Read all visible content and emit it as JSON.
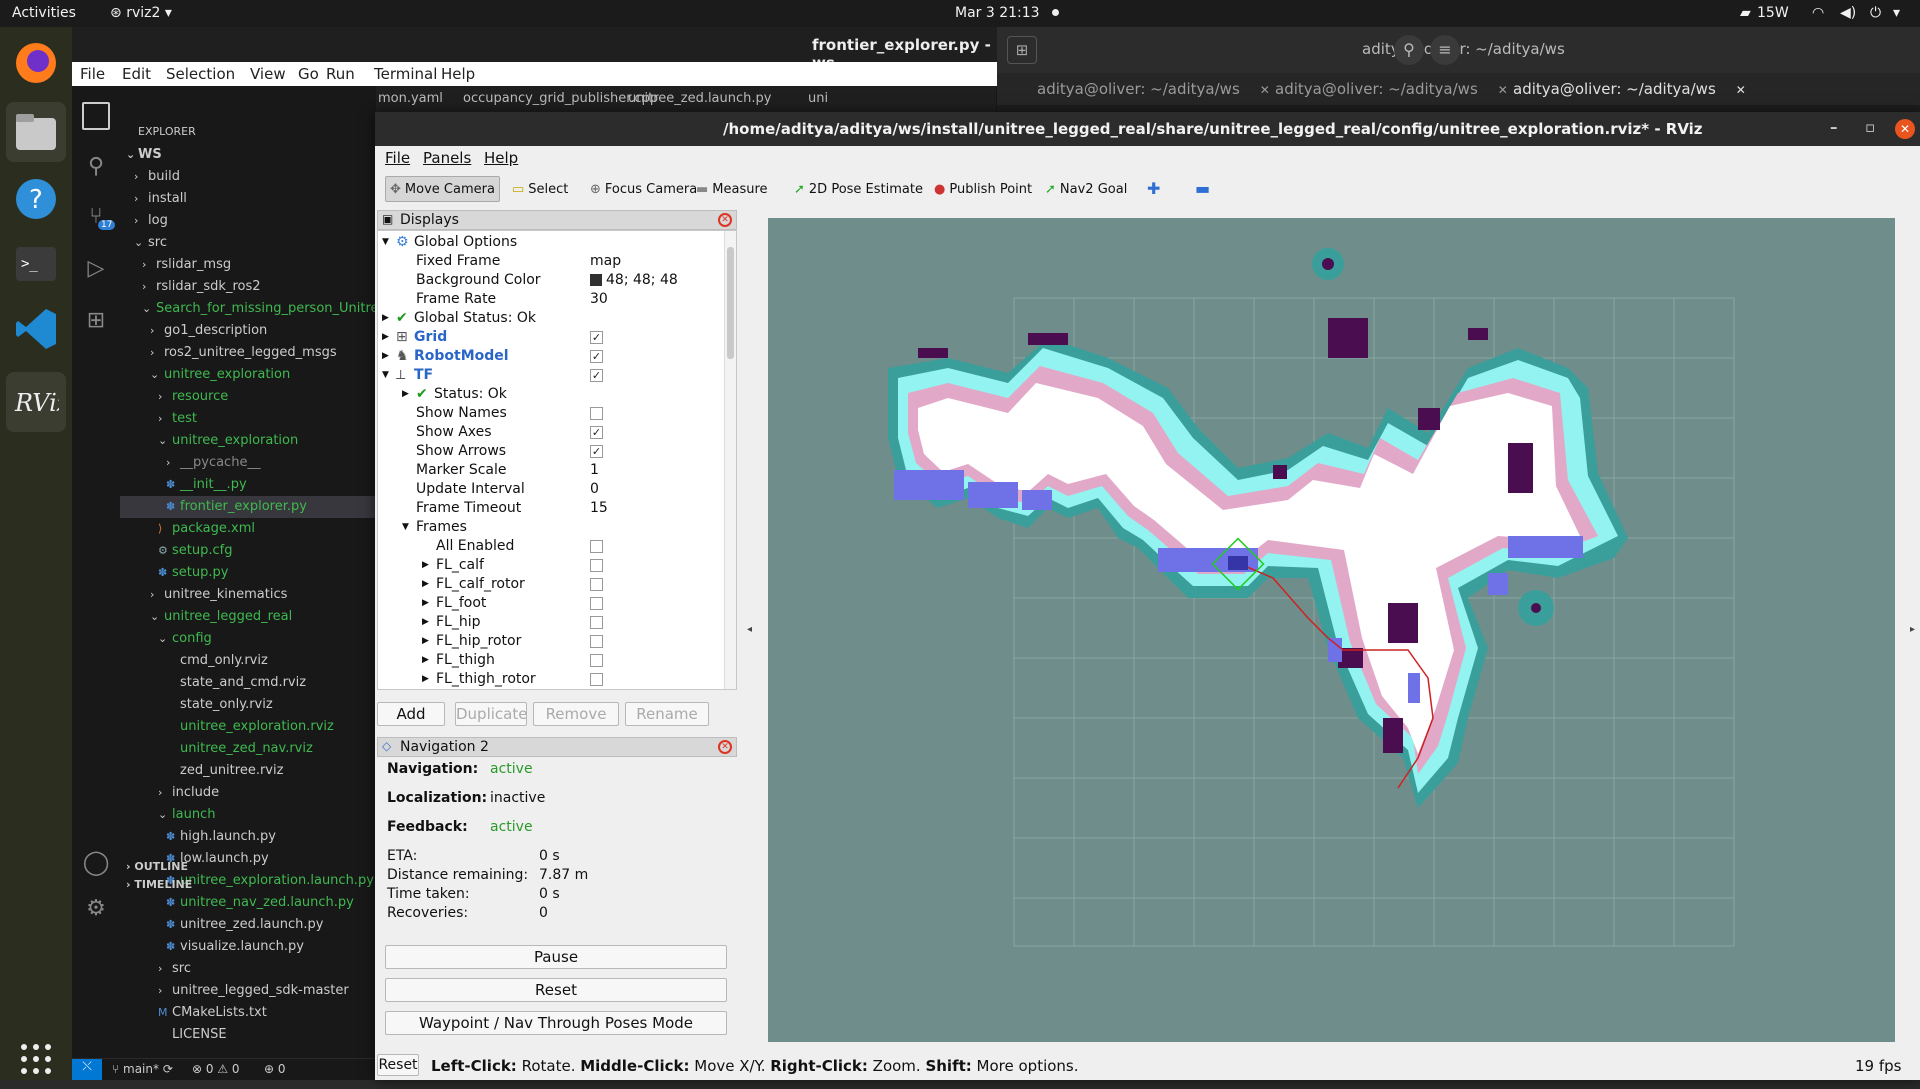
{
  "topbar": {
    "activities": "Activities",
    "app": "rviz2",
    "clock": "Mar 3  21:13",
    "power": "15W"
  },
  "vscode": {
    "title": "frontier_explorer.py - ws",
    "menu": [
      "File",
      "Edit",
      "Selection",
      "View",
      "Go",
      "Run",
      "Terminal",
      "Help"
    ],
    "explorer_label": "EXPLORER",
    "root": "WS",
    "badge": "17",
    "tabs": [
      "mon.yaml",
      "occupancy_grid_publisher.cpp",
      "unitree_zed.launch.py",
      "uni"
    ],
    "tree": [
      {
        "t": "build",
        "d": 1,
        "k": "f"
      },
      {
        "t": "install",
        "d": 1,
        "k": "f"
      },
      {
        "t": "log",
        "d": 1,
        "k": "f"
      },
      {
        "t": "src",
        "d": 1,
        "k": "o"
      },
      {
        "t": "rslidar_msg",
        "d": 2,
        "k": "f"
      },
      {
        "t": "rslidar_sdk_ros2",
        "d": 2,
        "k": "f"
      },
      {
        "t": "Search_for_missing_person_Unitre...",
        "d": 2,
        "k": "o",
        "c": "#3fb950"
      },
      {
        "t": "go1_description",
        "d": 3,
        "k": "f"
      },
      {
        "t": "ros2_unitree_legged_msgs",
        "d": 3,
        "k": "f"
      },
      {
        "t": "unitree_exploration",
        "d": 3,
        "k": "o",
        "c": "#3fb950"
      },
      {
        "t": "resource",
        "d": 4,
        "k": "f",
        "c": "#3fb950"
      },
      {
        "t": "test",
        "d": 4,
        "k": "f",
        "c": "#3fb950"
      },
      {
        "t": "unitree_exploration",
        "d": 4,
        "k": "o",
        "c": "#3fb950"
      },
      {
        "t": "__pycache__",
        "d": 5,
        "k": "f",
        "c": "#888"
      },
      {
        "t": "__init__.py",
        "d": 5,
        "k": "py",
        "c": "#3fb950"
      },
      {
        "t": "frontier_explorer.py",
        "d": 5,
        "k": "py",
        "c": "#3fb950",
        "sel": true
      },
      {
        "t": "package.xml",
        "d": 4,
        "k": "xml",
        "c": "#3fb950"
      },
      {
        "t": "setup.cfg",
        "d": 4,
        "k": "cfg",
        "c": "#3fb950"
      },
      {
        "t": "setup.py",
        "d": 4,
        "k": "py",
        "c": "#3fb950"
      },
      {
        "t": "unitree_kinematics",
        "d": 3,
        "k": "f"
      },
      {
        "t": "unitree_legged_real",
        "d": 3,
        "k": "o",
        "c": "#3fb950"
      },
      {
        "t": "config",
        "d": 4,
        "k": "o",
        "c": "#3fb950"
      },
      {
        "t": "cmd_only.rviz",
        "d": 5,
        "k": "n"
      },
      {
        "t": "state_and_cmd.rviz",
        "d": 5,
        "k": "n"
      },
      {
        "t": "state_only.rviz",
        "d": 5,
        "k": "n"
      },
      {
        "t": "unitree_exploration.rviz",
        "d": 5,
        "k": "n",
        "c": "#3fb950"
      },
      {
        "t": "unitree_zed_nav.rviz",
        "d": 5,
        "k": "n",
        "c": "#3fb950"
      },
      {
        "t": "zed_unitree.rviz",
        "d": 5,
        "k": "n"
      },
      {
        "t": "include",
        "d": 4,
        "k": "f"
      },
      {
        "t": "launch",
        "d": 4,
        "k": "o",
        "c": "#3fb950"
      },
      {
        "t": "high.launch.py",
        "d": 5,
        "k": "py"
      },
      {
        "t": "low.launch.py",
        "d": 5,
        "k": "py"
      },
      {
        "t": "unitree_exploration.launch.py",
        "d": 5,
        "k": "py",
        "c": "#3fb950"
      },
      {
        "t": "unitree_nav_zed.launch.py",
        "d": 5,
        "k": "py",
        "c": "#3fb950"
      },
      {
        "t": "unitree_zed.launch.py",
        "d": 5,
        "k": "py"
      },
      {
        "t": "visualize.launch.py",
        "d": 5,
        "k": "py"
      },
      {
        "t": "src",
        "d": 4,
        "k": "f"
      },
      {
        "t": "unitree_legged_sdk-master",
        "d": 4,
        "k": "f"
      },
      {
        "t": "CMakeLists.txt",
        "d": 4,
        "k": "m"
      },
      {
        "t": "LICENSE",
        "d": 4,
        "k": "n"
      }
    ],
    "outline": "OUTLINE",
    "timeline": "TIMELINE",
    "status": {
      "branch": "main*",
      "problems": "0",
      "warnings": "0",
      "ports": "0"
    }
  },
  "terminal": {
    "title": "aditya@oliver: ~/aditya/ws",
    "tabs": [
      "aditya@oliver: ~/aditya/ws",
      "aditya@oliver: ~/aditya/ws",
      "aditya@oliver: ~/aditya/ws"
    ]
  },
  "rviz": {
    "title": "/home/aditya/aditya/ws/install/unitree_legged_real/share/unitree_legged_real/config/unitree_exploration.rviz* - RViz",
    "menu": [
      "File",
      "Panels",
      "Help"
    ],
    "tools": [
      "Move Camera",
      "Select",
      "Focus Camera",
      "Measure",
      "2D Pose Estimate",
      "Publish Point",
      "Nav2 Goal"
    ],
    "displays_title": "Displays",
    "rows": [
      {
        "n": "Global Options",
        "x": 1,
        "e": "o",
        "i": "gear"
      },
      {
        "n": "Fixed Frame",
        "x": 2,
        "v": "map"
      },
      {
        "n": "Background Color",
        "x": 2,
        "v": "48; 48; 48",
        "sw": "#303030"
      },
      {
        "n": "Frame Rate",
        "x": 2,
        "v": "30"
      },
      {
        "n": "Global Status: Ok",
        "x": 1,
        "e": "c",
        "i": "check"
      },
      {
        "n": "Grid",
        "x": 1,
        "e": "c",
        "i": "grid",
        "b": true,
        "cb": true
      },
      {
        "n": "RobotModel",
        "x": 1,
        "e": "c",
        "i": "robot",
        "b": true,
        "cb": true
      },
      {
        "n": "TF",
        "x": 1,
        "e": "o",
        "i": "tf",
        "b": true,
        "cb": true
      },
      {
        "n": "Status: Ok",
        "x": 2,
        "e": "c",
        "i": "check"
      },
      {
        "n": "Show Names",
        "x": 2,
        "cb": false
      },
      {
        "n": "Show Axes",
        "x": 2,
        "cb": true
      },
      {
        "n": "Show Arrows",
        "x": 2,
        "cb": true
      },
      {
        "n": "Marker Scale",
        "x": 2,
        "v": "1"
      },
      {
        "n": "Update Interval",
        "x": 2,
        "v": "0"
      },
      {
        "n": "Frame Timeout",
        "x": 2,
        "v": "15"
      },
      {
        "n": "Frames",
        "x": 2,
        "e": "o"
      },
      {
        "n": "All Enabled",
        "x": 3,
        "cb": false
      },
      {
        "n": "FL_calf",
        "x": 3,
        "e": "c",
        "cb": false
      },
      {
        "n": "FL_calf_rotor",
        "x": 3,
        "e": "c",
        "cb": false
      },
      {
        "n": "FL_foot",
        "x": 3,
        "e": "c",
        "cb": false
      },
      {
        "n": "FL_hip",
        "x": 3,
        "e": "c",
        "cb": false
      },
      {
        "n": "FL_hip_rotor",
        "x": 3,
        "e": "c",
        "cb": false
      },
      {
        "n": "FL_thigh",
        "x": 3,
        "e": "c",
        "cb": false
      },
      {
        "n": "FL_thigh_rotor",
        "x": 3,
        "e": "c",
        "cb": false
      }
    ],
    "buttons": {
      "add": "Add",
      "duplicate": "Duplicate",
      "remove": "Remove",
      "rename": "Rename"
    },
    "nav_title": "Navigation 2",
    "nav": {
      "navigation_label": "Navigation:",
      "navigation": "active",
      "localization_label": "Localization:",
      "localization": "inactive",
      "feedback_label": "Feedback:",
      "feedback": "active",
      "eta_label": "ETA:",
      "eta": "0 s",
      "dist_label": "Distance remaining:",
      "dist": "7.87 m",
      "time_label": "Time taken:",
      "time": "0 s",
      "rec_label": "Recoveries:",
      "rec": "0",
      "pause": "Pause",
      "reset": "Reset",
      "waypoint": "Waypoint / Nav Through Poses Mode"
    },
    "status": {
      "reset": "Reset",
      "help": [
        [
          "Left-Click:",
          " Rotate. "
        ],
        [
          "Middle-Click:",
          " Move X/Y. "
        ],
        [
          "Right-Click:",
          " Zoom. "
        ],
        [
          "Shift:",
          " More options."
        ]
      ],
      "fps": "19 fps"
    }
  }
}
